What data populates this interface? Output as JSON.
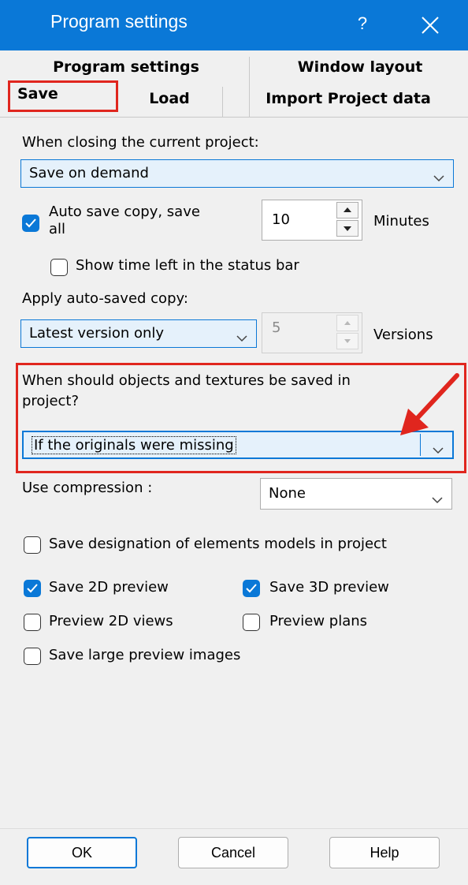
{
  "window": {
    "title": "Program settings",
    "help_label": "?",
    "close_icon": "close-icon"
  },
  "tabs": {
    "row1": [
      "Program settings",
      "Window layout"
    ],
    "row2": [
      "Save",
      "Load",
      "Import Project data"
    ],
    "selected": "Save"
  },
  "closing": {
    "label": "When closing the current project:",
    "value": "Save on demand"
  },
  "auto_save": {
    "checkbox_line1": "Auto save copy, save",
    "checkbox_line2": "all",
    "checked": true,
    "interval": "10",
    "unit": "Minutes",
    "show_time_label": "Show time left in the status bar",
    "show_time_checked": false
  },
  "apply_autosaved": {
    "label": "Apply auto-saved copy:",
    "value": "Latest version only",
    "versions_count": "5",
    "versions_unit": "Versions"
  },
  "objects_textures": {
    "label_line1": "When should objects and textures be saved in",
    "label_line2": "project?",
    "value": "If the originals were missing"
  },
  "compression": {
    "label": "Use compression :",
    "value": "None"
  },
  "options": {
    "save_designation": {
      "label": "Save designation of elements models in project",
      "checked": false
    },
    "save_2d_preview": {
      "label": "Save 2D preview",
      "checked": true
    },
    "save_3d_preview": {
      "label": "Save 3D preview",
      "checked": true
    },
    "preview_2d_views": {
      "label": "Preview 2D views",
      "checked": false
    },
    "preview_plans": {
      "label": "Preview plans",
      "checked": false
    },
    "save_large_preview": {
      "label": "Save large preview images",
      "checked": false
    }
  },
  "buttons": {
    "ok": "OK",
    "cancel": "Cancel",
    "help": "Help"
  },
  "colors": {
    "titlebar": "#0a78d7",
    "accent": "#0a78d7",
    "annotation_red": "#e0261e"
  }
}
